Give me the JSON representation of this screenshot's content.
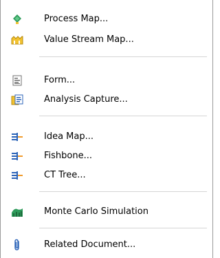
{
  "menu": {
    "items": [
      {
        "label": "Process Map...",
        "icon": "process-map-icon"
      },
      {
        "label": "Value Stream Map...",
        "icon": "value-stream-map-icon"
      },
      {
        "label": "Form...",
        "icon": "form-icon"
      },
      {
        "label": "Analysis Capture...",
        "icon": "analysis-capture-icon"
      },
      {
        "label": "Idea Map...",
        "icon": "idea-map-icon"
      },
      {
        "label": "Fishbone...",
        "icon": "fishbone-icon"
      },
      {
        "label": "CT Tree...",
        "icon": "ct-tree-icon"
      },
      {
        "label": "Monte Carlo Simulation",
        "icon": "monte-carlo-icon"
      },
      {
        "label": "Related Document...",
        "icon": "paperclip-icon"
      }
    ]
  },
  "colors": {
    "accent_green": "#2e9b5b",
    "accent_yellow": "#f2c230",
    "accent_blue": "#2b63b8",
    "accent_orange": "#f09a2a",
    "separator": "#d4d4d4"
  }
}
